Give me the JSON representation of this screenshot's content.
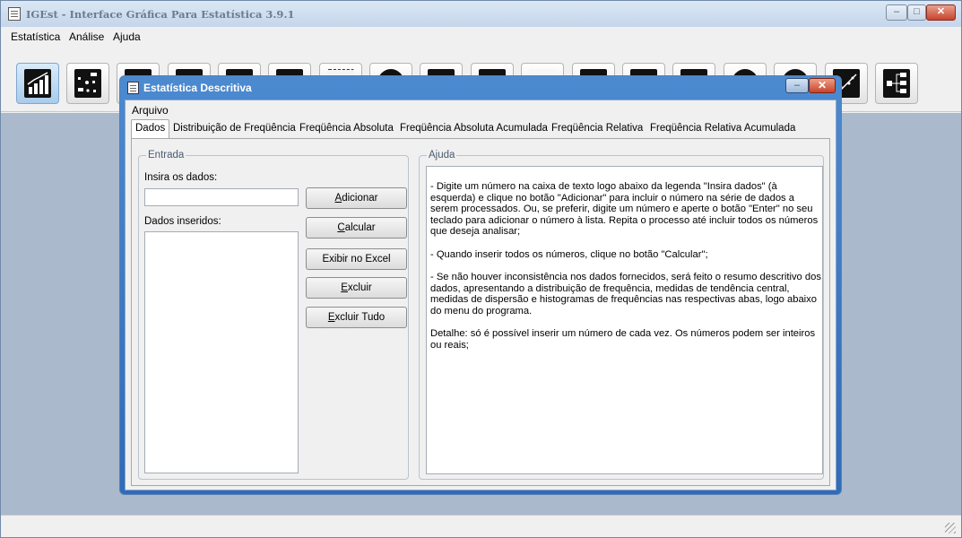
{
  "app": {
    "title": "IGEst - Interface Gráfica Para Estatística 3.9.1",
    "menu": [
      "Estatística",
      "Análise",
      "Ajuda"
    ],
    "window_controls": {
      "minimize": "–",
      "maximize": "□",
      "close": "✕"
    }
  },
  "toolbar": {
    "buttons": [
      {
        "icon": "line-chart-icon",
        "active": true
      },
      {
        "icon": "scatter-plot-icon"
      },
      {
        "icon": "area-chart-icon"
      },
      {
        "icon": "bar-chart-icon"
      },
      {
        "icon": "horizontal-bar-chart-icon"
      },
      {
        "icon": "table-icon"
      },
      {
        "icon": "dot-plot-icon"
      },
      {
        "icon": "pie-chart-icon"
      },
      {
        "icon": "histogram-icon"
      },
      {
        "icon": "curve-chart-icon"
      },
      {
        "icon": "blank-chart-icon"
      },
      {
        "icon": "calculator-icon"
      },
      {
        "icon": "grid-table-icon"
      },
      {
        "icon": "stats-panel-icon"
      },
      {
        "icon": "circle-chart-icon"
      },
      {
        "icon": "gauge-icon"
      },
      {
        "icon": "regression-icon"
      },
      {
        "icon": "tree-diagram-icon"
      }
    ]
  },
  "dialog": {
    "title": "Estatística Descritiva",
    "controls": {
      "minimize": "–",
      "close": "✕"
    },
    "menu": [
      "Arquivo"
    ],
    "tabs": [
      "Dados",
      "Distribuição de Freqüência",
      "Freqüência Absoluta",
      "Freqüência Absoluta Acumulada",
      "Freqüência Relativa",
      "Freqüência Relativa Acumulada"
    ],
    "selected_tab": "Dados",
    "entrada": {
      "legend": "Entrada",
      "input_label": "Insira os dados:",
      "input_value": "",
      "list_label": "Dados inseridos:",
      "list_items": [],
      "buttons": {
        "adicionar": {
          "mnemonic": "A",
          "rest": "dicionar"
        },
        "calcular": {
          "mnemonic": "C",
          "rest": "alcular"
        },
        "excel": {
          "label": "Exibir no Excel"
        },
        "excluir": {
          "mnemonic": "E",
          "rest": "xcluir"
        },
        "excluir_tudo": {
          "mnemonic": "E",
          "rest": "xcluir Tudo"
        }
      }
    },
    "ajuda": {
      "legend": "Ajuda",
      "paragraphs": [
        "- Digite um número na caixa de texto logo abaixo da legenda \"Insira dados\" (à esquerda) e clique no botão \"Adicionar\" para incluir o número na série de dados a serem processados. Ou, se preferir, digite um número e aperte o botão \"Enter\" no seu teclado para adicionar o número à lista. Repita o processo até incluir todos os números que deseja analisar;",
        "- Quando inserir todos os números, clique no botão \"Calcular\";",
        "- Se não houver inconsistência nos dados fornecidos, será feito o resumo descritivo dos dados, apresentando a distribuição de frequência, medidas de tendência central, medidas de dispersão e histogramas de frequências nas respectivas abas, logo abaixo do menu do programa.",
        "Detalhe: só é possível inserir um número de cada vez. Os números podem ser inteiros ou reais;"
      ]
    }
  }
}
